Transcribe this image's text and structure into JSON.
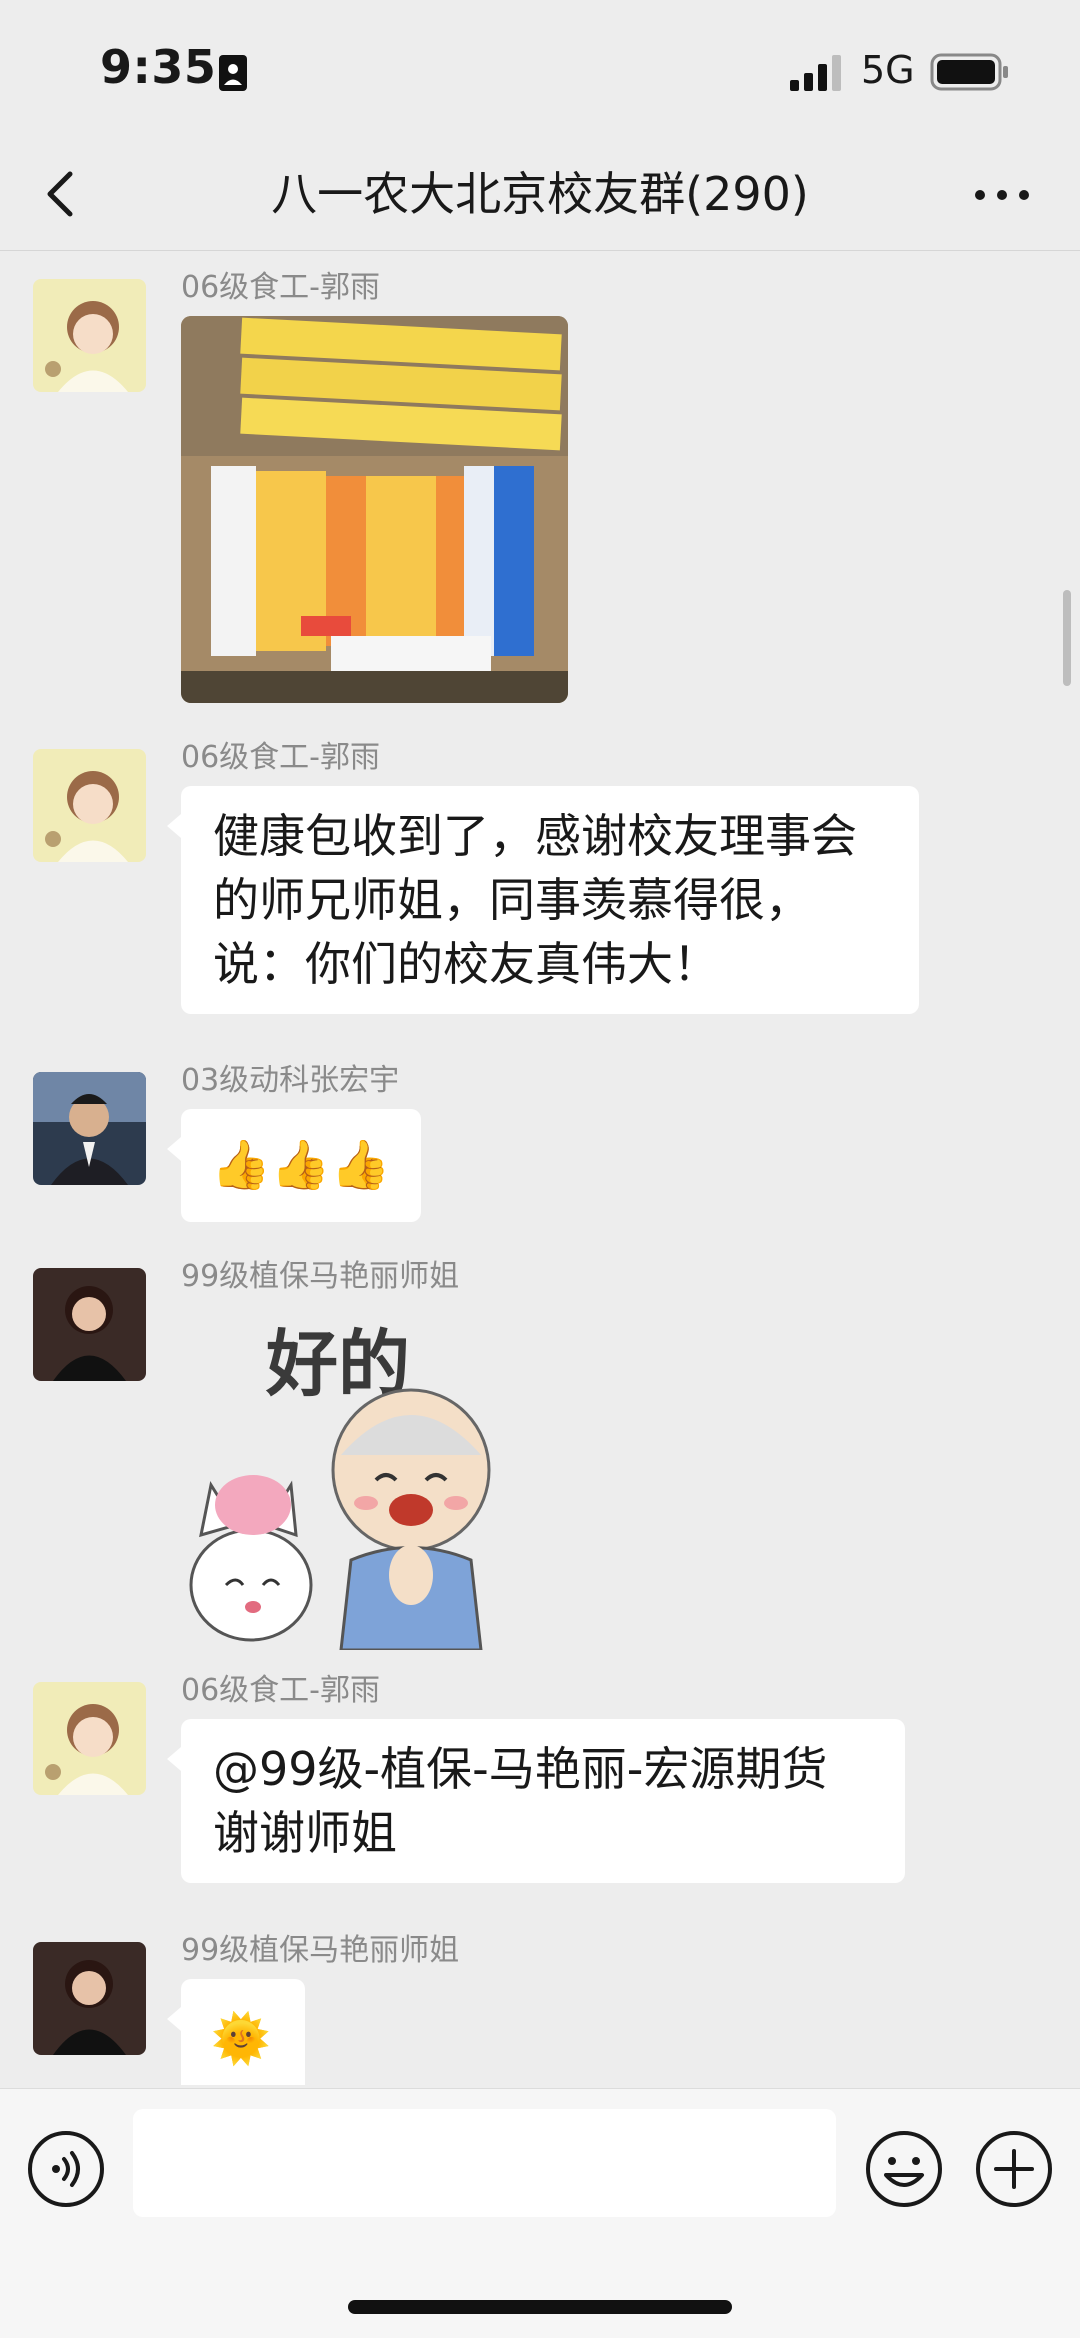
{
  "status_bar": {
    "time": "9:35",
    "network": "5G"
  },
  "header": {
    "title": "八一农大北京校友群(290)"
  },
  "messages": [
    {
      "sender": "06级食工-郭雨",
      "type": "image"
    },
    {
      "sender": "06级食工-郭雨",
      "lines": [
        "健康包收到了，感谢校友理事会",
        "的师兄师姐，同事羡慕得很，",
        "说：你们的校友真伟大！"
      ]
    },
    {
      "sender": "03级动科张宏宇",
      "emoji": "👍👍👍"
    },
    {
      "sender": "99级植保马艳丽师姐",
      "sticker_text": "好的"
    },
    {
      "sender": "06级食工-郭雨",
      "lines": [
        "@99级-植保-马艳丽-宏源期货",
        "谢谢师姐"
      ]
    },
    {
      "sender": "99级植保马艳丽师姐",
      "emoji": "🌞"
    }
  ],
  "input": {
    "value": "",
    "placeholder": ""
  },
  "colors": {
    "background": "#ededed",
    "bubble": "#ffffff",
    "sender": "#8a8a8a"
  }
}
